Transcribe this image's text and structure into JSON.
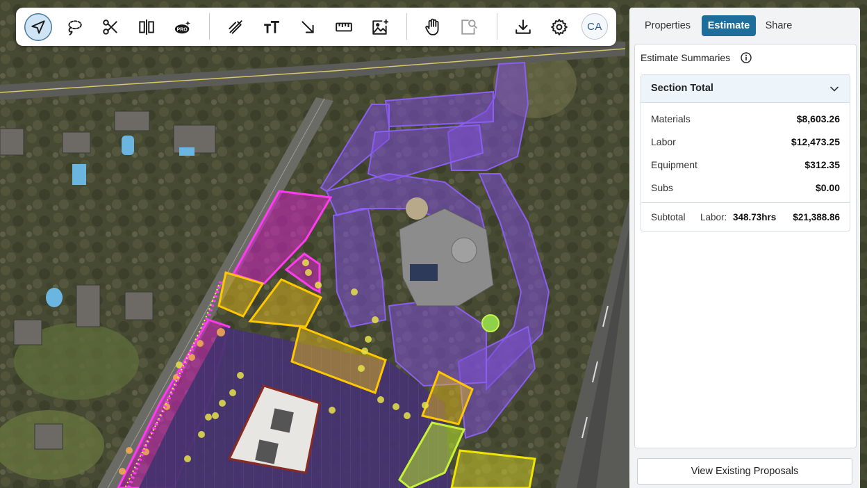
{
  "toolbar": {
    "tools": [
      {
        "icon": "navigate-arrow-icon",
        "active": true
      },
      {
        "icon": "lasso-icon",
        "active": false
      },
      {
        "icon": "scissors-icon",
        "active": false
      },
      {
        "icon": "split-icon",
        "active": false
      },
      {
        "icon": "ai-pro-icon",
        "active": false,
        "badge": "PRO"
      },
      {
        "icon": "draw-pen-icon",
        "active": false
      },
      {
        "icon": "text-icon",
        "active": false
      },
      {
        "icon": "arrow-icon",
        "active": false
      },
      {
        "icon": "ruler-icon",
        "active": false
      },
      {
        "icon": "add-image-icon",
        "active": false
      },
      {
        "icon": "hand-pan-icon",
        "active": false
      },
      {
        "icon": "zoom-area-icon",
        "active": false
      },
      {
        "icon": "download-icon",
        "active": false
      },
      {
        "icon": "settings-gear-icon",
        "active": false
      }
    ],
    "avatar_initials": "CA"
  },
  "panel": {
    "tabs": [
      {
        "label": "Properties",
        "active": false
      },
      {
        "label": "Estimate",
        "active": true
      },
      {
        "label": "Share",
        "active": false
      }
    ],
    "estimate_summaries_title": "Estimate Summaries",
    "section": {
      "title": "Section Total",
      "rows": [
        {
          "label": "Materials",
          "value": "$8,603.26"
        },
        {
          "label": "Labor",
          "value": "$12,473.25"
        },
        {
          "label": "Equipment",
          "value": "$312.35"
        },
        {
          "label": "Subs",
          "value": "$0.00"
        }
      ],
      "subtotal": {
        "label": "Subtotal",
        "labor_label": "Labor:",
        "labor_hours": "348.73hrs",
        "amount": "$21,388.86"
      }
    },
    "view_proposals_button": "View Existing Proposals"
  },
  "colors": {
    "accent": "#1d6e9b",
    "zone_purple": "#7b4fd6",
    "zone_magenta": "#e21fd4",
    "zone_yellow": "#f0c419",
    "zone_lime": "#b7e22b"
  }
}
